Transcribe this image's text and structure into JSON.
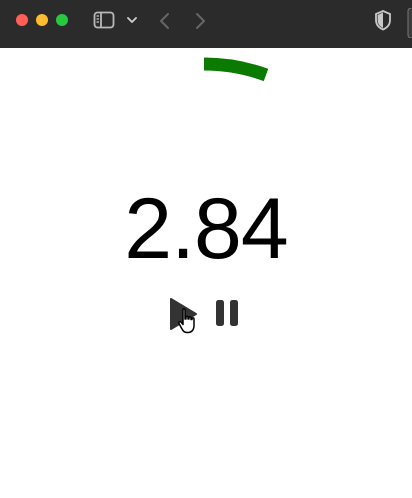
{
  "window": {
    "traffic_lights": [
      "close-icon",
      "minimize-icon",
      "zoom-icon"
    ],
    "toolbar_icons": [
      "sidebar-toggle-icon",
      "chevron-down-icon",
      "back-arrow-icon",
      "forward-arrow-icon",
      "shield-icon"
    ]
  },
  "gauge": {
    "value_text": "2.84",
    "arc_color": "#0a7a00"
  },
  "controls": {
    "play_icon": "play-icon",
    "pause_icon": "pause-icon"
  }
}
